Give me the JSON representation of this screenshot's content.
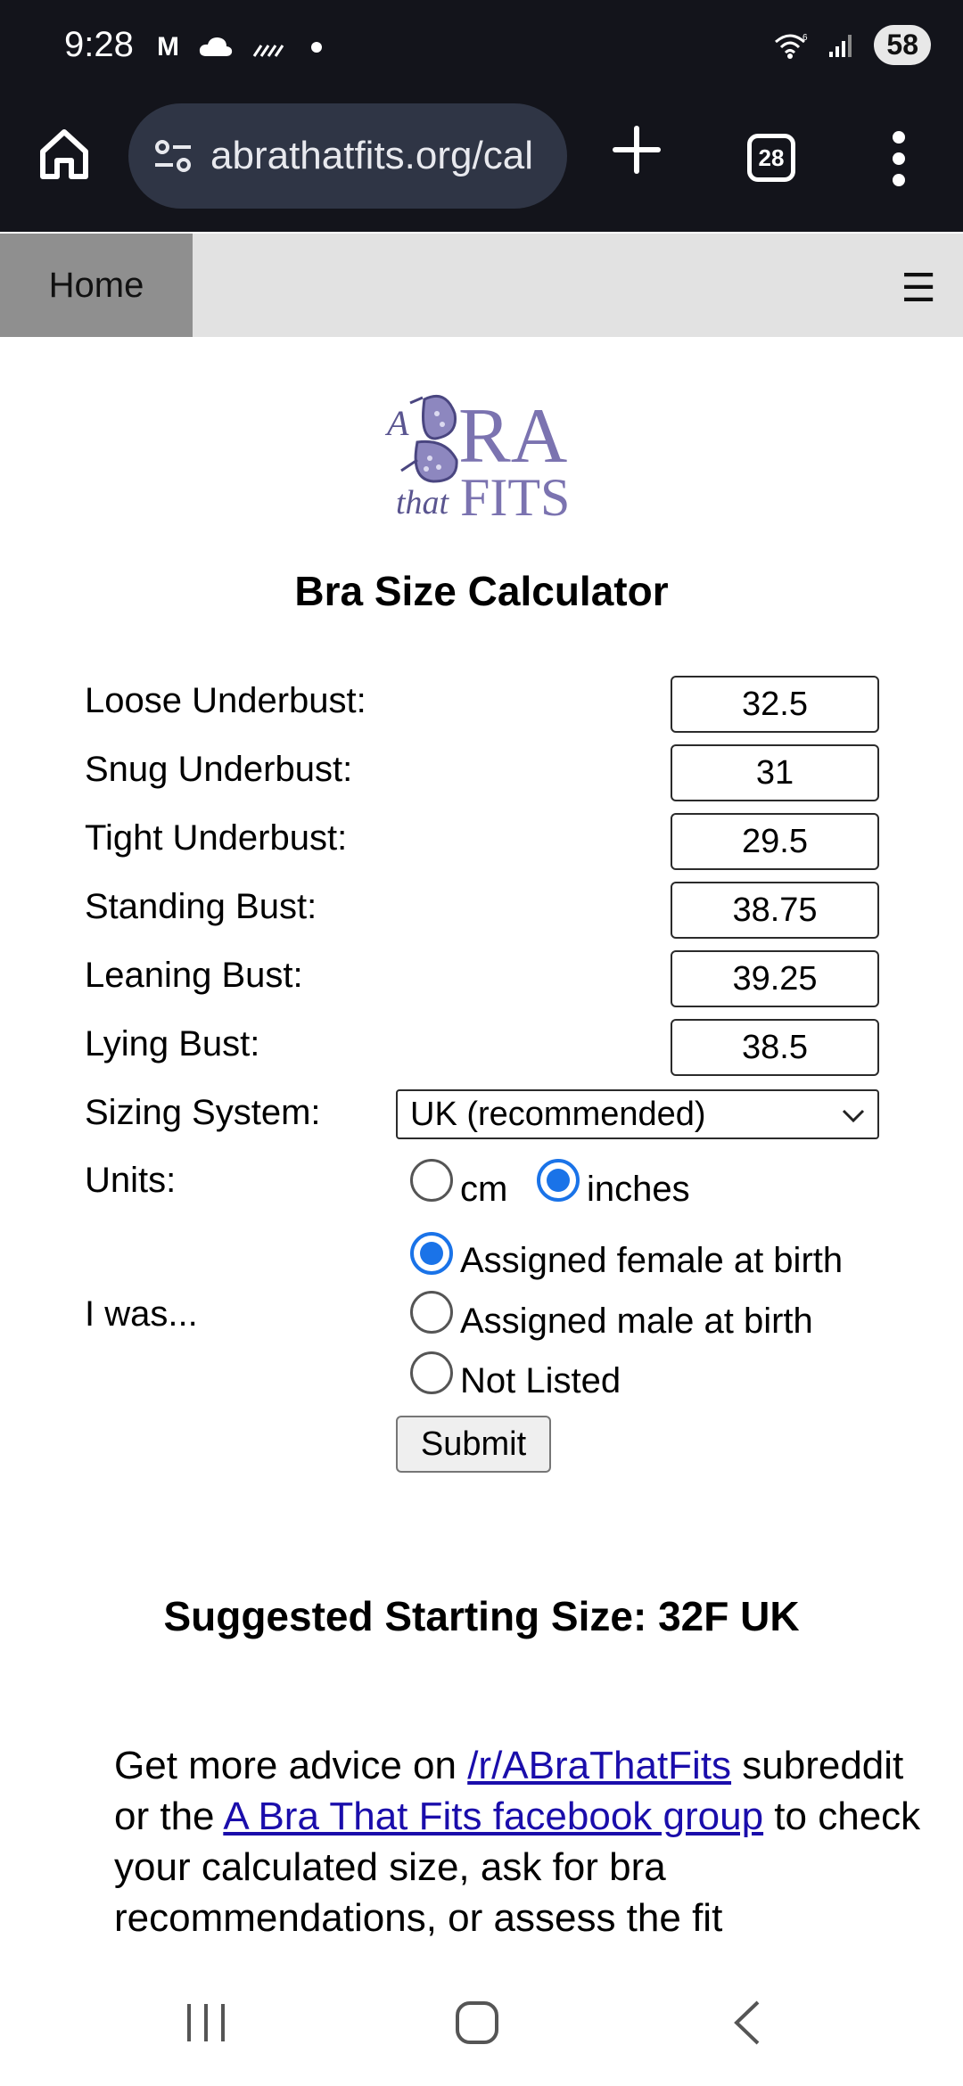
{
  "status_bar": {
    "time": "9:28",
    "battery": "58",
    "icons": [
      "gmail-icon",
      "cloud-icon",
      "signal-strength-icon",
      "dot-icon",
      "wifi-icon",
      "cell-signal-icon"
    ]
  },
  "browser": {
    "url": "abrathatfits.org/cal",
    "tab_count": "28"
  },
  "site_nav": {
    "home_label": "Home",
    "menu_glyph": "☰"
  },
  "logo": {
    "a": "A",
    "ra": "RA",
    "that": "that",
    "fits": "FITS"
  },
  "calculator": {
    "title": "Bra Size Calculator",
    "fields": [
      {
        "label": "Loose Underbust:",
        "value": "32.5"
      },
      {
        "label": "Snug Underbust:",
        "value": "31"
      },
      {
        "label": "Tight Underbust:",
        "value": "29.5"
      },
      {
        "label": "Standing Bust:",
        "value": "38.75"
      },
      {
        "label": "Leaning Bust:",
        "value": "39.25"
      },
      {
        "label": "Lying Bust:",
        "value": "38.5"
      }
    ],
    "sizing_system": {
      "label": "Sizing System:",
      "selected": "UK (recommended)"
    },
    "units": {
      "label": "Units:",
      "options": [
        "cm",
        "inches"
      ],
      "selected": "inches"
    },
    "assigned": {
      "label": "I was...",
      "options": [
        "Assigned female at birth",
        "Assigned male at birth",
        "Not Listed"
      ],
      "selected": "Assigned female at birth"
    },
    "submit_label": "Submit"
  },
  "result": {
    "suggested": "Suggested Starting Size: 32F UK"
  },
  "advice": {
    "part1": "Get more advice on ",
    "link1": "/r/ABraThatFits",
    "part2": " subreddit or the ",
    "link2": "A Bra That Fits facebook group",
    "part3": " to check your calculated size, ask for bra recommendations, or assess the fit"
  },
  "colors": {
    "chrome_bg": "#13141b",
    "url_bg": "#2f3545",
    "nav_bg": "#e2e2e2",
    "nav_home_bg": "#8f8f8f",
    "radio_accent": "#1a73e8",
    "logo_purple": "#7b73b0",
    "link": "#1a0dab"
  }
}
